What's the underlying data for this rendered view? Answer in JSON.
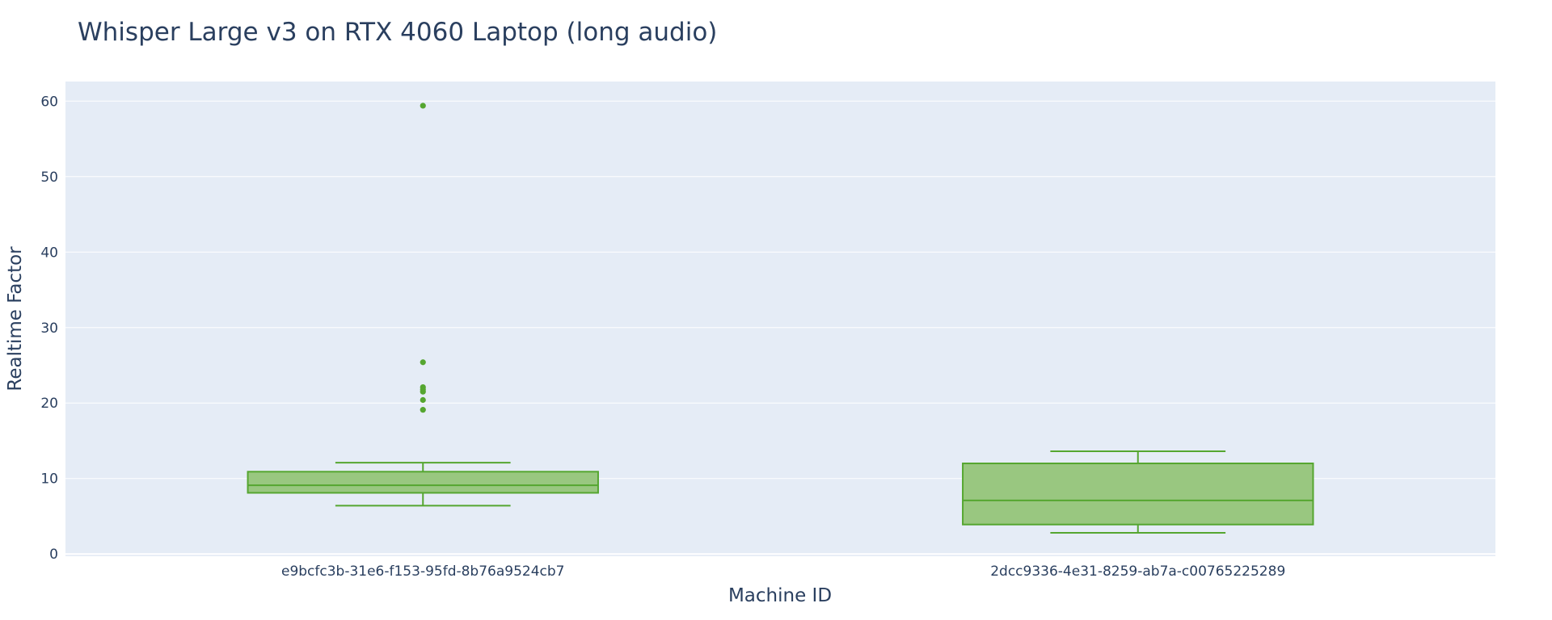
{
  "chart_data": {
    "type": "box",
    "title": "Whisper Large v3 on RTX 4060 Laptop (long audio)",
    "xlabel": "Machine ID",
    "ylabel": "Realtime Factor",
    "ylim": [
      -0.3,
      62.6
    ],
    "yticks": [
      0,
      10,
      20,
      30,
      40,
      50,
      60
    ],
    "grid": true,
    "legend": "none",
    "colors": {
      "plot_bg": "#e5ecf6",
      "grid": "#ffffff",
      "box_fill": "#99c780",
      "box_line": "#55a630",
      "text": "#2a3f5f"
    },
    "categories": [
      "e9bcfc3b-31e6-f153-95fd-8b76a9524cb7",
      "2dcc9336-4e31-8259-ab7a-c00765225289"
    ],
    "boxes": [
      {
        "category": "e9bcfc3b-31e6-f153-95fd-8b76a9524cb7",
        "lowerfence": 6.4,
        "q1": 8.1,
        "median": 9.1,
        "q3": 10.9,
        "upperfence": 12.1,
        "outliers": [
          59.4,
          25.4,
          22.1,
          21.8,
          21.5,
          20.4,
          19.1
        ]
      },
      {
        "category": "2dcc9336-4e31-8259-ab7a-c00765225289",
        "lowerfence": 2.8,
        "q1": 3.9,
        "median": 7.1,
        "q3": 12.0,
        "upperfence": 13.6,
        "outliers": []
      }
    ]
  }
}
